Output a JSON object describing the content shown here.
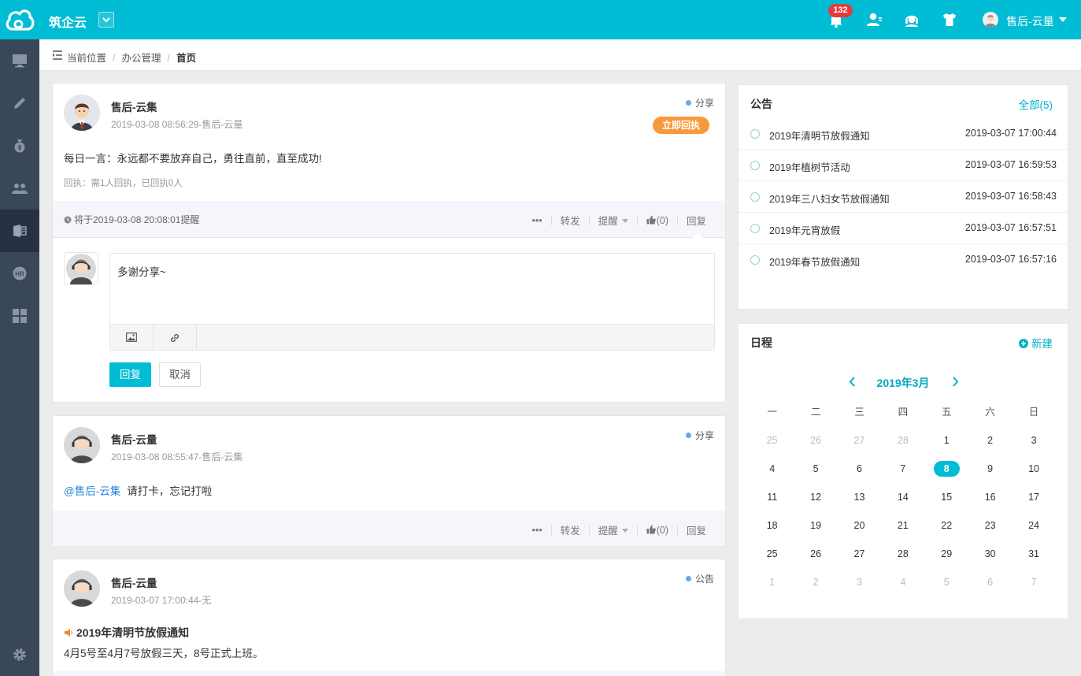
{
  "app": {
    "brand": "筑企云",
    "notification_count": "132",
    "user_name": "售后-云量"
  },
  "breadcrumb": {
    "label": "当前位置",
    "items": [
      "办公管理",
      "首页"
    ]
  },
  "posts": [
    {
      "author": "售后-云集",
      "meta": "2019-03-08 08:56:29-售后-云量",
      "type": "分享",
      "ack_button": "立即回执",
      "content": "每日一言：永远都不要放弃自己，勇往直前，直至成功!",
      "ack_info": "回执：需1人回执，已回执0人",
      "remind": "将于2019-03-08 20:08:01提醒",
      "reply_text": "多谢分享~",
      "reply_button": "回复",
      "cancel_button": "取消"
    },
    {
      "author": "售后-云量",
      "meta": "2019-03-08 08:55:47-售后-云集",
      "type": "分享",
      "mention": "@售后-云集",
      "content": "请打卡，忘记打啦"
    },
    {
      "author": "售后-云量",
      "meta": "2019-03-07 17:00:44-无",
      "type": "公告",
      "notice_title": "2019年清明节放假通知",
      "content": "4月5号至4月7号放假三天，8号正式上班。"
    }
  ],
  "actions": {
    "more": "•••",
    "forward": "转发",
    "remind": "提醒",
    "like": "(0)",
    "reply": "回复"
  },
  "notices": {
    "title": "公告",
    "all_link": "全部(5)",
    "items": [
      {
        "title": "2019年清明节放假通知",
        "time": "2019-03-07 17:00:44"
      },
      {
        "title": "2019年植树节活动",
        "time": "2019-03-07 16:59:53"
      },
      {
        "title": "2019年三八妇女节放假通知",
        "time": "2019-03-07 16:58:43"
      },
      {
        "title": "2019年元宵放假",
        "time": "2019-03-07 16:57:51"
      },
      {
        "title": "2019年春节放假通知",
        "time": "2019-03-07 16:57:16"
      }
    ]
  },
  "schedule": {
    "title": "日程",
    "new_link": "新建",
    "month": "2019年3月",
    "weekdays": [
      "一",
      "二",
      "三",
      "四",
      "五",
      "六",
      "日"
    ],
    "today": "8",
    "weeks": [
      [
        {
          "d": "25",
          "dim": true
        },
        {
          "d": "26",
          "dim": true
        },
        {
          "d": "27",
          "dim": true
        },
        {
          "d": "28",
          "dim": true
        },
        {
          "d": "1"
        },
        {
          "d": "2"
        },
        {
          "d": "3"
        }
      ],
      [
        {
          "d": "4"
        },
        {
          "d": "5"
        },
        {
          "d": "6"
        },
        {
          "d": "7"
        },
        {
          "d": "8",
          "today": true
        },
        {
          "d": "9"
        },
        {
          "d": "10"
        }
      ],
      [
        {
          "d": "11"
        },
        {
          "d": "12"
        },
        {
          "d": "13"
        },
        {
          "d": "14"
        },
        {
          "d": "15"
        },
        {
          "d": "16"
        },
        {
          "d": "17"
        }
      ],
      [
        {
          "d": "18"
        },
        {
          "d": "19"
        },
        {
          "d": "20"
        },
        {
          "d": "21"
        },
        {
          "d": "22"
        },
        {
          "d": "23"
        },
        {
          "d": "24"
        }
      ],
      [
        {
          "d": "25"
        },
        {
          "d": "26"
        },
        {
          "d": "27"
        },
        {
          "d": "28"
        },
        {
          "d": "29"
        },
        {
          "d": "30"
        },
        {
          "d": "31"
        }
      ],
      [
        {
          "d": "1",
          "dim": true
        },
        {
          "d": "2",
          "dim": true
        },
        {
          "d": "3",
          "dim": true
        },
        {
          "d": "4",
          "dim": true
        },
        {
          "d": "5",
          "dim": true
        },
        {
          "d": "6",
          "dim": true
        },
        {
          "d": "7",
          "dim": true
        }
      ]
    ]
  },
  "colors": {
    "accent": "#00bcd4",
    "sidebar": "#3a4759",
    "badge": "#e83a3a",
    "ack_button": "#f89a3c"
  }
}
